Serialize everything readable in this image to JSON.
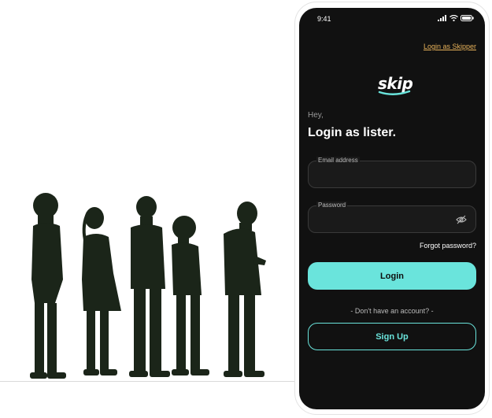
{
  "status_bar": {
    "time": "9:41"
  },
  "header": {
    "login_as_skipper": "Login as Skipper"
  },
  "brand": {
    "logo_text": "skip"
  },
  "form": {
    "greeting": "Hey,",
    "heading": "Login as lister.",
    "email": {
      "label": "Email address",
      "value": ""
    },
    "password": {
      "label": "Password",
      "value": ""
    },
    "forgot_password": "Forgot password?",
    "login_button": "Login",
    "no_account": "- Don't have an account? -",
    "signup_button": "Sign Up"
  },
  "colors": {
    "accent": "#6ae4dc",
    "link": "#e8b25a",
    "screen_bg": "#111111",
    "silhouette": "#1a2418"
  },
  "illustration": {
    "subject": "people-waiting-in-line-silhouettes"
  }
}
